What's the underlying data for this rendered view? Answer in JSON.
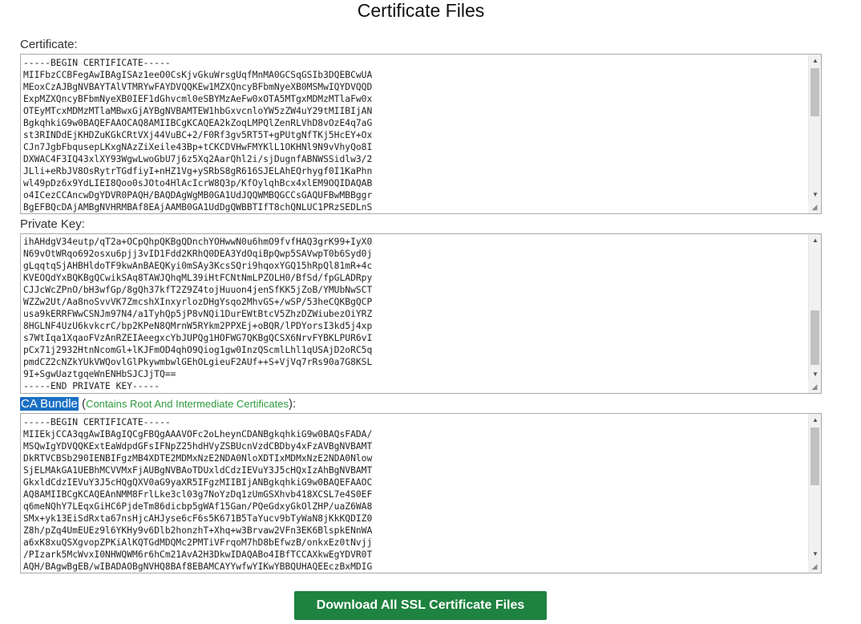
{
  "page": {
    "title": "Certificate Files"
  },
  "certificate": {
    "label": "Certificate:",
    "text": "-----BEGIN CERTIFICATE-----\nMIIFbzCCBFegAwIBAgISAz1eeO0CsKjvGkuWrsgUqfMnMA0GCSqGSIb3DQEBCwUA\nMEoxCzAJBgNVBAYTAlVTMRYwFAYDVQQKEw1MZXQncyBFbmNyeXB0MSMwIQYDVQQD\nExpMZXQncyBFbmNyeXB0IEF1dGhvcml0eSBYMzAeFw0xOTA5MTgxMDMzMTlaFw0x\nOTEyMTcxMDMzMTlaMBwxGjAYBgNVBAMTEW1hbGxvcnloYW5zZW4uY29tMIIBIjAN\nBgkqhkiG9w0BAQEFAAOCAQ8AMIIBCgKCAQEA2kZoqLMPQlZenRLVhD8vOzE4q7aG\nst3RINDdEjKHDZuKGkCRtVXj44VuBC+2/F0Rf3gv5RT5T+gPUtgNfTKj5HcEY+Ox\nCJn7JgbFbqusepLKxgNAzZiXeile43Bp+tCKCDVHwFMYKlL1OKHNl9N9vVhyQo8I\nDXWAC4F3IQ43xlXY93WgwLwoGbU7j6z5Xq2AarQhl2i/sjDugnfABNWSSidlw3/2\nJLli+eRbJV8OsRytrTGdfiyI+nHZ1Vg+ySRbS8gR616SJELAhEQrhygf0I1KaPhn\nwl49pDz6x9YdLIEI8Qoo0sJOto4HlAcIcrW8Q3p/KfOylqhBcx4xlEM9OQIDAQAB\no4ICezCCAncwDgYDVR0PAQH/BAQDAgWgMB0GA1UdJQQWMBQGCCsGAQUFBwMBBggr\nBgEFBQcDAjAMBgNVHRMBAf8EAjAAMB0GA1UdDgQWBBTIfT8chQNLUC1PRzSEDLnS"
  },
  "private_key": {
    "label": "Private Key:",
    "text": "ihAHdgV34eutp/qT2a+OCpQhpQKBgQDnchYOHwwN0u6hmO9fvfHAQ3grK99+IyX0\nN69vOtWRqo692osxu6pjj3vID1Fdd2KRhQ0DEA3YdOqiBpQwp5SAVwpT0b6Syd0j\ngLqqtqSjAHBHldoTF9kwAnBAEQKyi0mSAy3KcsSQri9hqoxYGQ15hRpQl81mR+4c\nKVEOQdYxBQKBgQCwikSAq8TAWJQhqML39iHtFCNtNmLPZOLH0/BfSd/fpGLADRpy\nCJJcWcZPnO/bH3wfGp/8gQh37kfT2Z9Z4tojHuuon4jenSfKK5jZoB/YMUbNwSCT\nWZZw2Ut/Aa8noSvvVK7ZmcshXInxyrlozDHgYsqo2MhvGS+/wSP/53heCQKBgQCP\nusa9kERRFWwCSNJm97N4/a1TyhQp5jP8vNQi1DurEWtBtcV5ZhzDZWiubezOiYRZ\n8HGLNF4UzU6kvkcrC/bp2KPeN8QMrnW5RYkm2PPXEj+oBQR/lPDYorsI3kd5j4xp\ns7WtIqa1XqaoFVzAnRZEIAeegxcYbJUPQg1HOFWG7QKBgQCSX6NrvFYBKLPUR6vI\npCx71j2932HtnNcomGl+lKJFmOD4qhO9Qiog1gw0InzQScmlLhl1qUSAjD2oRC5q\npmdCZ2cNZkYUkVWQovlGlPkywmbwlGEhOLgieuF2AUf++S+VjVq7rRs90a7G8KSL\n9I+SgwUaztgqeWnENHbSJCJjTQ==\n-----END PRIVATE KEY-----"
  },
  "ca_bundle": {
    "label": "CA Bundle",
    "note": "Contains Root And Intermediate Certificates",
    "open_paren": " (",
    "close_paren": "):",
    "text": "-----BEGIN CERTIFICATE-----\nMIIEkjCCA3qgAwIBAgIQCgFBQgAAAVOFc2oLheynCDANBgkqhkiG9w0BAQsFADA/\nMSQwIgYDVQQKExtEaWdpdGFsIFNpZ25hdHVyZSBUcnVzdCBDby4xFzAVBgNVBAMT\nDkRTVCBSb290IENBIFgzMB4XDTE2MDMxNzE2NDA0NloXDTIxMDMxNzE2NDA0Nlow\nSjELMAkGA1UEBhMCVVMxFjAUBgNVBAoTDUxldCdzIEVuY3J5cHQxIzAhBgNVBAMT\nGkxldCdzIEVuY3J5cHQgQXV0aG9yaXR5IFgzMIIBIjANBgkqhkiG9w0BAQEFAAOC\nAQ8AMIIBCgKCAQEAnNMM8FrlLke3cl03g7NoYzDq1zUmGSXhvb418XCSL7e4S0EF\nq6meNQhY7LEqxGiHC6PjdeTm86dicbp5gWAf15Gan/PQeGdxyGkOlZHP/uaZ6WA8\nSMx+yk13EiSdRxta67nsHjcAHJyse6cF6s5K671B5TaYucv9bTyWaN8jKkKQDIZ0\nZ8h/pZq4UmEUEz9l6YKHy9v6Dlb2honzhT+Xhq+w3Brvaw2VFn3EK6BlspkENnWA\na6xK8xuQSXgvopZPKiAlKQTGdMDQMc2PMTiVFrqoM7hD8bEfwzB/onkxEz0tNvjj\n/PIzark5McWvxI0NHWQWM6r6hCm21AvA2H3DkwIDAQABo4IBfTCCAXkwEgYDVR0T\nAQH/BAgwBgEB/wIBADAOBgNVHQ8BAf8EBAMCAYYwfwYIKwYBBQUHAQEEczBxMDIG"
  },
  "actions": {
    "download_label": "Download All SSL Certificate Files"
  },
  "colors": {
    "button_bg": "#1e8340",
    "highlight_bg": "#1a6fc4",
    "note_text": "#2e9b3e"
  }
}
